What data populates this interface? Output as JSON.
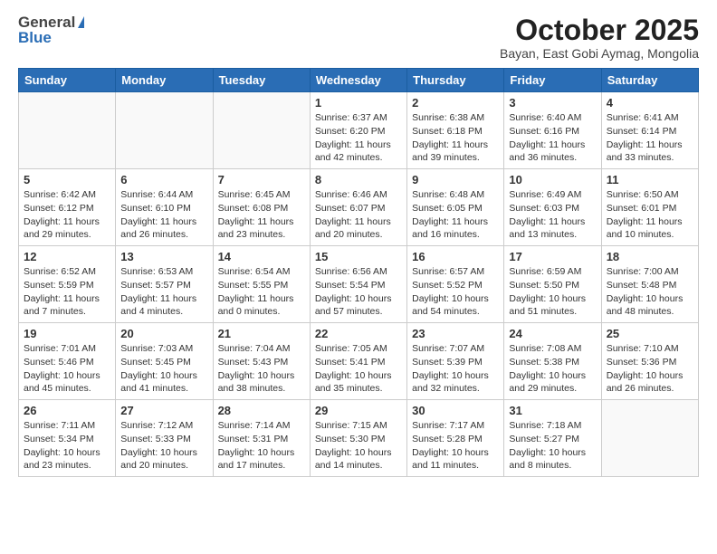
{
  "header": {
    "logo_general": "General",
    "logo_blue": "Blue",
    "month_title": "October 2025",
    "subtitle": "Bayan, East Gobi Aymag, Mongolia"
  },
  "weekdays": [
    "Sunday",
    "Monday",
    "Tuesday",
    "Wednesday",
    "Thursday",
    "Friday",
    "Saturday"
  ],
  "weeks": [
    [
      {
        "day": "",
        "info": ""
      },
      {
        "day": "",
        "info": ""
      },
      {
        "day": "",
        "info": ""
      },
      {
        "day": "1",
        "info": "Sunrise: 6:37 AM\nSunset: 6:20 PM\nDaylight: 11 hours\nand 42 minutes."
      },
      {
        "day": "2",
        "info": "Sunrise: 6:38 AM\nSunset: 6:18 PM\nDaylight: 11 hours\nand 39 minutes."
      },
      {
        "day": "3",
        "info": "Sunrise: 6:40 AM\nSunset: 6:16 PM\nDaylight: 11 hours\nand 36 minutes."
      },
      {
        "day": "4",
        "info": "Sunrise: 6:41 AM\nSunset: 6:14 PM\nDaylight: 11 hours\nand 33 minutes."
      }
    ],
    [
      {
        "day": "5",
        "info": "Sunrise: 6:42 AM\nSunset: 6:12 PM\nDaylight: 11 hours\nand 29 minutes."
      },
      {
        "day": "6",
        "info": "Sunrise: 6:44 AM\nSunset: 6:10 PM\nDaylight: 11 hours\nand 26 minutes."
      },
      {
        "day": "7",
        "info": "Sunrise: 6:45 AM\nSunset: 6:08 PM\nDaylight: 11 hours\nand 23 minutes."
      },
      {
        "day": "8",
        "info": "Sunrise: 6:46 AM\nSunset: 6:07 PM\nDaylight: 11 hours\nand 20 minutes."
      },
      {
        "day": "9",
        "info": "Sunrise: 6:48 AM\nSunset: 6:05 PM\nDaylight: 11 hours\nand 16 minutes."
      },
      {
        "day": "10",
        "info": "Sunrise: 6:49 AM\nSunset: 6:03 PM\nDaylight: 11 hours\nand 13 minutes."
      },
      {
        "day": "11",
        "info": "Sunrise: 6:50 AM\nSunset: 6:01 PM\nDaylight: 11 hours\nand 10 minutes."
      }
    ],
    [
      {
        "day": "12",
        "info": "Sunrise: 6:52 AM\nSunset: 5:59 PM\nDaylight: 11 hours\nand 7 minutes."
      },
      {
        "day": "13",
        "info": "Sunrise: 6:53 AM\nSunset: 5:57 PM\nDaylight: 11 hours\nand 4 minutes."
      },
      {
        "day": "14",
        "info": "Sunrise: 6:54 AM\nSunset: 5:55 PM\nDaylight: 11 hours\nand 0 minutes."
      },
      {
        "day": "15",
        "info": "Sunrise: 6:56 AM\nSunset: 5:54 PM\nDaylight: 10 hours\nand 57 minutes."
      },
      {
        "day": "16",
        "info": "Sunrise: 6:57 AM\nSunset: 5:52 PM\nDaylight: 10 hours\nand 54 minutes."
      },
      {
        "day": "17",
        "info": "Sunrise: 6:59 AM\nSunset: 5:50 PM\nDaylight: 10 hours\nand 51 minutes."
      },
      {
        "day": "18",
        "info": "Sunrise: 7:00 AM\nSunset: 5:48 PM\nDaylight: 10 hours\nand 48 minutes."
      }
    ],
    [
      {
        "day": "19",
        "info": "Sunrise: 7:01 AM\nSunset: 5:46 PM\nDaylight: 10 hours\nand 45 minutes."
      },
      {
        "day": "20",
        "info": "Sunrise: 7:03 AM\nSunset: 5:45 PM\nDaylight: 10 hours\nand 41 minutes."
      },
      {
        "day": "21",
        "info": "Sunrise: 7:04 AM\nSunset: 5:43 PM\nDaylight: 10 hours\nand 38 minutes."
      },
      {
        "day": "22",
        "info": "Sunrise: 7:05 AM\nSunset: 5:41 PM\nDaylight: 10 hours\nand 35 minutes."
      },
      {
        "day": "23",
        "info": "Sunrise: 7:07 AM\nSunset: 5:39 PM\nDaylight: 10 hours\nand 32 minutes."
      },
      {
        "day": "24",
        "info": "Sunrise: 7:08 AM\nSunset: 5:38 PM\nDaylight: 10 hours\nand 29 minutes."
      },
      {
        "day": "25",
        "info": "Sunrise: 7:10 AM\nSunset: 5:36 PM\nDaylight: 10 hours\nand 26 minutes."
      }
    ],
    [
      {
        "day": "26",
        "info": "Sunrise: 7:11 AM\nSunset: 5:34 PM\nDaylight: 10 hours\nand 23 minutes."
      },
      {
        "day": "27",
        "info": "Sunrise: 7:12 AM\nSunset: 5:33 PM\nDaylight: 10 hours\nand 20 minutes."
      },
      {
        "day": "28",
        "info": "Sunrise: 7:14 AM\nSunset: 5:31 PM\nDaylight: 10 hours\nand 17 minutes."
      },
      {
        "day": "29",
        "info": "Sunrise: 7:15 AM\nSunset: 5:30 PM\nDaylight: 10 hours\nand 14 minutes."
      },
      {
        "day": "30",
        "info": "Sunrise: 7:17 AM\nSunset: 5:28 PM\nDaylight: 10 hours\nand 11 minutes."
      },
      {
        "day": "31",
        "info": "Sunrise: 7:18 AM\nSunset: 5:27 PM\nDaylight: 10 hours\nand 8 minutes."
      },
      {
        "day": "",
        "info": ""
      }
    ]
  ]
}
